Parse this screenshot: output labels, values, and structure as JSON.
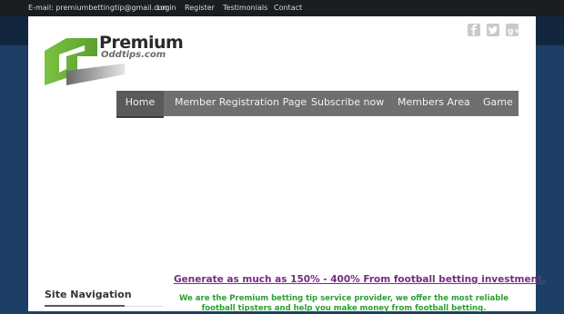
{
  "topbar": {
    "email": "E-mail: premiumbettingtip@gmail.com",
    "links": [
      "Login",
      "Register",
      "Testimonials",
      "Contact"
    ]
  },
  "logo": {
    "title": "Premium",
    "subtitle": "Oddtips.com",
    "colors": {
      "green": "#7bc143",
      "gray": "#8a8a8a"
    }
  },
  "social": [
    {
      "icon": "facebook-icon"
    },
    {
      "icon": "twitter-icon"
    },
    {
      "icon": "google-plus-icon"
    }
  ],
  "nav": {
    "items": [
      "Home",
      "Member Registration Page",
      "Subscribe now",
      "Members Area",
      "Game"
    ],
    "active_index": 0
  },
  "main": {
    "promo": "Generate as much as 150% - 400% From football betting investment.",
    "intro": "We are the Premium betting tip service provider, we offer the most reliable football tipsters and help you make money from football betting."
  },
  "sidebar": {
    "title": "Site Navigation"
  }
}
